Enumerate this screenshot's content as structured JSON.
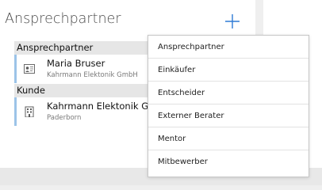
{
  "header": {
    "title": "Ansprechpartner"
  },
  "sections": [
    {
      "header": "Ansprechpartner",
      "card": {
        "name": "Maria Bruser",
        "subtitle": "Kahrmann Elektonik GmbH",
        "icon": "contact-card-icon"
      }
    },
    {
      "header": "Kunde",
      "card": {
        "name": "Kahrmann Elektonik GmbH",
        "subtitle": "Paderborn",
        "icon": "building-icon"
      }
    }
  ],
  "dropdown": {
    "items": [
      "Ansprechpartner",
      "Einkäufer",
      "Entscheider",
      "Externer Berater",
      "Mentor",
      "Mitbewerber"
    ]
  },
  "colors": {
    "accent": "#2e7bd6",
    "card_stripe": "#9cc4e8"
  }
}
